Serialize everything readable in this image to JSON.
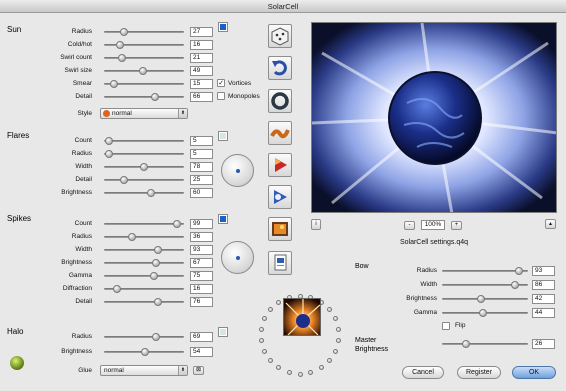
{
  "window": {
    "title": "SolarCell"
  },
  "sun": {
    "title": "Sun",
    "rows": [
      {
        "label": "Radius",
        "value": "27"
      },
      {
        "label": "Cold/hot",
        "value": "16"
      },
      {
        "label": "Swirl count",
        "value": "21"
      },
      {
        "label": "Swirl size",
        "value": "49"
      },
      {
        "label": "Smear",
        "value": "15"
      },
      {
        "label": "Detail",
        "value": "66"
      }
    ],
    "color": "#1a5fd0",
    "vortices_label": "Vortices",
    "vortices_checked": "✓",
    "monopoles_label": "Monopoles",
    "style_label": "Style",
    "style_value": "normal"
  },
  "flares": {
    "title": "Flares",
    "rows": [
      {
        "label": "Count",
        "value": "5"
      },
      {
        "label": "Radius",
        "value": "5"
      },
      {
        "label": "Width",
        "value": "78"
      },
      {
        "label": "Detail",
        "value": "25"
      },
      {
        "label": "Brightness",
        "value": "60"
      }
    ]
  },
  "spikes": {
    "title": "Spikes",
    "rows": [
      {
        "label": "Count",
        "value": "99"
      },
      {
        "label": "Radius",
        "value": "36"
      },
      {
        "label": "Width",
        "value": "93"
      },
      {
        "label": "Brightness",
        "value": "67"
      },
      {
        "label": "Gamma",
        "value": "75"
      },
      {
        "label": "Diffraction",
        "value": "16"
      },
      {
        "label": "Detail",
        "value": "76"
      }
    ],
    "color": "#1a5fd0"
  },
  "halo": {
    "title": "Halo",
    "rows": [
      {
        "label": "Radius",
        "value": "69"
      },
      {
        "label": "Brightness",
        "value": "54"
      }
    ]
  },
  "glue": {
    "label": "Glue",
    "value": "normal"
  },
  "preview": {
    "zoom": "100%",
    "minus": "-",
    "plus": "+",
    "info": "i",
    "up": "▲",
    "filename": "SolarCell settings.q4q"
  },
  "bow": {
    "title": "Bow",
    "rows": [
      {
        "label": "Radius",
        "value": "93"
      },
      {
        "label": "Width",
        "value": "86"
      },
      {
        "label": "Brightness",
        "value": "42"
      },
      {
        "label": "Gamma",
        "value": "44"
      }
    ],
    "flip_label": "Flip",
    "extra_value": "26"
  },
  "master": {
    "line1": "Master",
    "line2": "Brightness"
  },
  "buttons": {
    "cancel": "Cancel",
    "register": "Register",
    "ok": "OK"
  }
}
